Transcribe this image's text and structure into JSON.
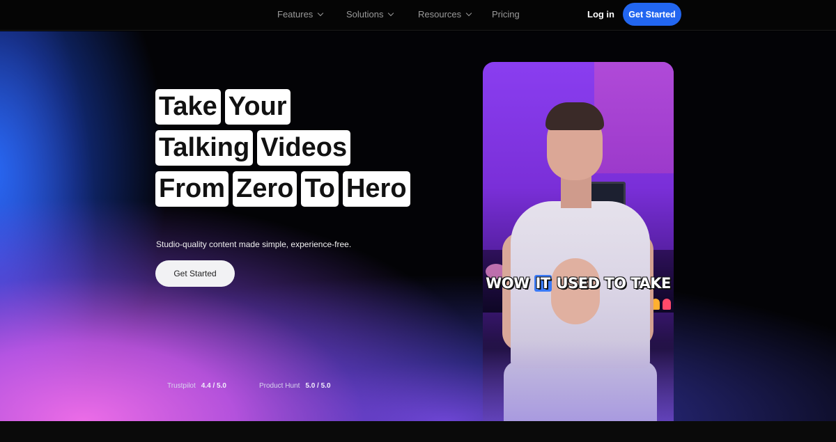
{
  "nav": {
    "items": [
      {
        "label": "Features",
        "dropdown": true
      },
      {
        "label": "Solutions",
        "dropdown": true
      },
      {
        "label": "Resources",
        "dropdown": true
      },
      {
        "label": "Pricing",
        "dropdown": false
      }
    ],
    "login_label": "Log in",
    "cta_label": "Get Started"
  },
  "hero": {
    "headline_rows": [
      [
        "Take",
        "Your"
      ],
      [
        "Talking",
        "Videos"
      ],
      [
        "From",
        "Zero",
        "To",
        "Hero"
      ]
    ],
    "subtitle": "Studio-quality content made simple, experience-free.",
    "cta_label": "Get Started",
    "ratings": [
      {
        "source": "Trustpilot",
        "score": "4.4 / 5.0"
      },
      {
        "source": "Product Hunt",
        "score": "5.0 / 5.0"
      }
    ]
  },
  "video": {
    "caption_before": "WOW ",
    "caption_highlight": "IT",
    "caption_after": " USED TO TAKE"
  },
  "colors": {
    "accent": "#2266f0",
    "background": "#000000"
  }
}
